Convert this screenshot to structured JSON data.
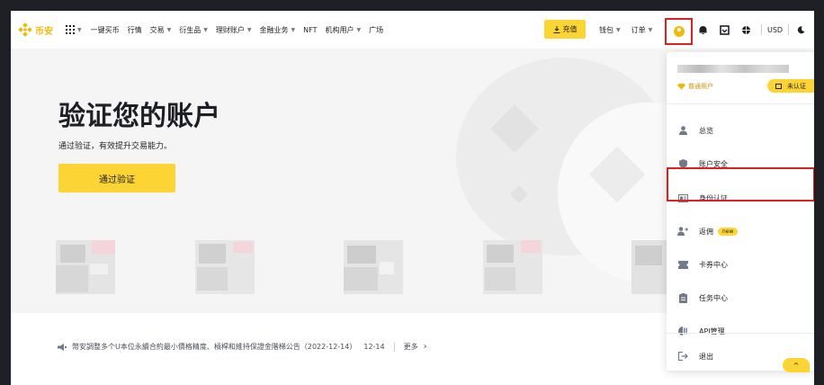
{
  "header": {
    "logo_text": "币安",
    "nav": [
      {
        "label": "一键买币",
        "caret": false
      },
      {
        "label": "行情",
        "caret": false
      },
      {
        "label": "交易",
        "caret": true
      },
      {
        "label": "衍生品",
        "caret": true
      },
      {
        "label": "理财账户",
        "caret": true
      },
      {
        "label": "金融业务",
        "caret": true
      },
      {
        "label": "NFT",
        "caret": false
      },
      {
        "label": "机构用户",
        "caret": true
      },
      {
        "label": "广场",
        "caret": false
      }
    ],
    "deposit_label": "充值",
    "wallet_label": "钱包",
    "orders_label": "订单",
    "currency": "USD"
  },
  "hero": {
    "title": "验证您的账户",
    "subtitle": "通过验证，有效提升交易能力。",
    "button": "通过验证"
  },
  "announcement": {
    "text": "幣安調整多个U本位永續合約最小價格精度、槓桿和維持保證金階梯公告（2022-12-14）",
    "date": "12-14",
    "more": "更多"
  },
  "user_menu": {
    "level": "普通用户",
    "verify_badge": "未认证",
    "items": [
      {
        "label": "总览",
        "icon": "user-icon"
      },
      {
        "label": "账户安全",
        "icon": "shield-icon"
      },
      {
        "label": "身份认证",
        "icon": "id-card-icon",
        "highlighted": true
      },
      {
        "label": "返佣",
        "icon": "add-user-icon",
        "badge": "new"
      },
      {
        "label": "卡券中心",
        "icon": "coupon-icon"
      },
      {
        "label": "任务中心",
        "icon": "task-icon"
      },
      {
        "label": "API管理",
        "icon": "api-icon"
      },
      {
        "label": "退出",
        "icon": "logout-icon"
      }
    ]
  },
  "colors": {
    "brand": "#f0b90b",
    "button": "#fcd535",
    "highlight": "#e02020",
    "text": "#1e2026"
  }
}
